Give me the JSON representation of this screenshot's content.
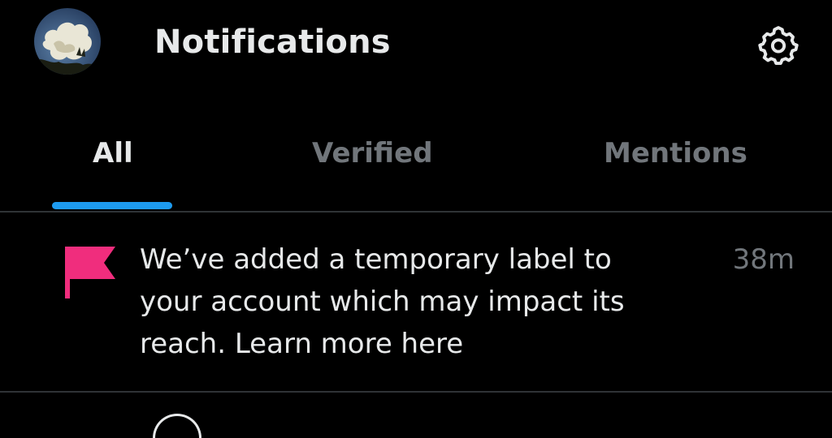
{
  "header": {
    "title": "Notifications",
    "avatar_icon": "profile-avatar",
    "settings_icon": "gear-icon"
  },
  "tabs": [
    {
      "label": "All",
      "active": true
    },
    {
      "label": "Verified",
      "active": false
    },
    {
      "label": "Mentions",
      "active": false
    }
  ],
  "notifications": [
    {
      "icon": "flag-icon",
      "text": "We’ve added a temporary label to your account which may impact its reach. Learn more here",
      "time": "38m"
    }
  ],
  "colors": {
    "background": "#000000",
    "text_primary": "#e7e9ea",
    "text_secondary": "#71767b",
    "accent": "#1d9bf0",
    "flag": "#f02d7d",
    "divider": "#2f3336"
  }
}
